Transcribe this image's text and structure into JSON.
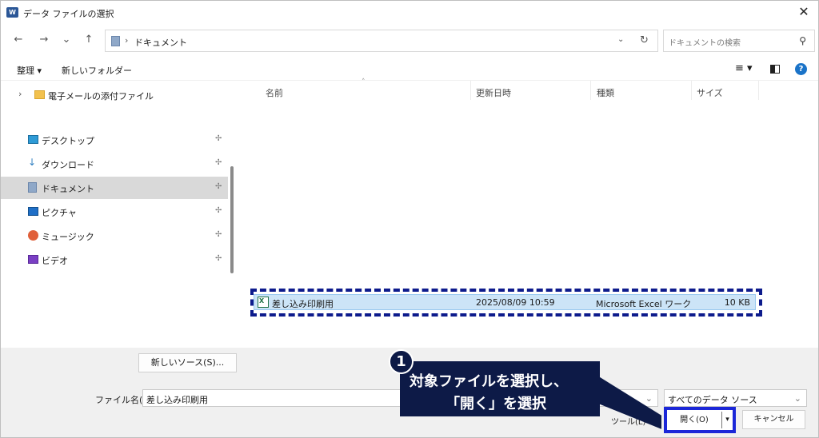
{
  "window": {
    "title": "データ ファイルの選択",
    "close_glyph": "✕"
  },
  "nav": {
    "back": "←",
    "forward": "→",
    "recent": "⌄",
    "up": "↑",
    "address": {
      "separator": "›",
      "location": "ドキュメント",
      "dropdown": "⌄",
      "refresh": "↻"
    },
    "search": {
      "placeholder": "ドキュメントの検索",
      "icon": "⚲"
    }
  },
  "toolbar": {
    "organize": "整理 ▾",
    "new_folder": "新しいフォルダー",
    "view": "≡ ▾",
    "help": "?"
  },
  "sidebar": {
    "expand_item": {
      "label": "電子メールの添付ファイル",
      "expand": "›"
    },
    "items": [
      {
        "label": "デスクトップ",
        "pin": "📌"
      },
      {
        "label": "ダウンロード",
        "pin": "📌"
      },
      {
        "label": "ドキュメント",
        "pin": "📌",
        "selected": true
      },
      {
        "label": "ピクチャ",
        "pin": "📌"
      },
      {
        "label": "ミュージック",
        "pin": "📌"
      },
      {
        "label": "ビデオ",
        "pin": "📌"
      }
    ]
  },
  "filelist": {
    "columns": {
      "name": "名前",
      "date": "更新日時",
      "type": "種類",
      "size": "サイズ"
    },
    "sort_caret": "˄",
    "rows": [
      {
        "name": "差し込み印刷用",
        "date": "2025/08/09 10:59",
        "type": "Microsoft Excel ワーク...",
        "size": "10 KB"
      }
    ]
  },
  "bottom": {
    "new_source": "新しいソース(S)...",
    "filename_label": "ファイル名(N):",
    "filename_value": "差し込み印刷用",
    "filename_dropdown": "⌄",
    "filetype": "すべてのデータ ソース",
    "tools": "ツール(L) ▾",
    "open": "開く(O)",
    "open_split": "▾",
    "cancel": "キャンセル"
  },
  "callout": {
    "number": "1",
    "line1": "対象ファイルを選択し、",
    "line2": "「開く」を選択"
  },
  "colors": {
    "selection": "#cce4f7",
    "callout": "#0d1a47",
    "highlight": "#0d1b8c",
    "open_border": "#1b27d8"
  }
}
